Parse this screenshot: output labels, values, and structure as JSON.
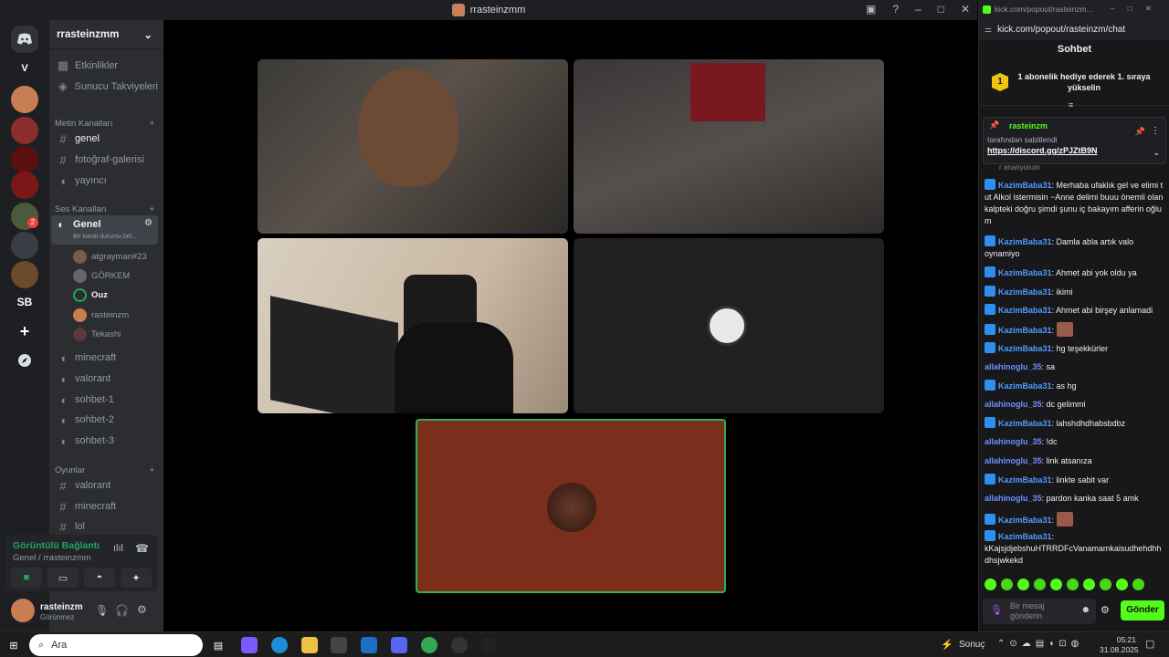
{
  "window": {
    "title": "rrasteinzmm"
  },
  "server": {
    "name": "rrasteinzmm"
  },
  "rail": {
    "dm_letter": "V",
    "sb_label": "SB",
    "badge": "2"
  },
  "channels": {
    "top": [
      "Etkinlikler",
      "Sunucu Takviyeleri"
    ],
    "text_category": "Metin Kanalları",
    "text": [
      "genel",
      "fotoğraf-galerisi",
      "yayıncı"
    ],
    "voice_category": "Ses Kanalları",
    "active_voice": "Genel",
    "active_voice_status": "Bir kanal durumu bel...",
    "voice_users": [
      "atgrayman#23",
      "GÖRKEM",
      "Ouz",
      "rasteinzm",
      "Tekashi"
    ],
    "voice": [
      "minecraft",
      "valorant",
      "sohbet-1",
      "sohbet-2",
      "sohbet-3"
    ],
    "games_category": "Oyunlar",
    "games": [
      "valorant",
      "minecraft",
      "lol"
    ]
  },
  "voice_panel": {
    "status": "Görüntülü Bağlantı",
    "sub": "Genel / rrasteinzmm"
  },
  "user_panel": {
    "name": "rasteinzm",
    "status": "Görünmez"
  },
  "stage": {
    "accent": "#2fb24c",
    "tile_bg": "#7a2e1b"
  },
  "kick": {
    "tab_url": "kick.com/popout/rasteinzm...",
    "url": "kick.com/popout/rasteinzm/chat",
    "header": "Sohbet",
    "goal_rank": "1",
    "goal_text": "1 abonelik hediye ederek 1. sıraya yükselin",
    "pinned_user": "rasteinzm",
    "pinned_by": "tarafından sabitlendi",
    "pinned_link": "https://discord.gg/zPJZtB9N",
    "cut_line": "r ananyorum",
    "messages": [
      {
        "user": "KazimBaba31",
        "text": "Merhaba ufaklık gel ve elimi tut Alkol istermisin ~Anne delimi buuu önemli olan kalpteki doğru şimdi şunu iç bakayım afferin oğlum",
        "badge": true
      },
      {
        "user": "KazimBaba31",
        "text": "Damla abla artık valo oynamiyo",
        "badge": true
      },
      {
        "user": "KazimBaba31",
        "text": "Ahmet abi yok oldu ya",
        "badge": true
      },
      {
        "user": "KazimBaba31",
        "text": "ikimi",
        "badge": true
      },
      {
        "user": "KazimBaba31",
        "text": "Ahmet abi birşey anlamadi",
        "badge": true
      },
      {
        "user": "KazimBaba31",
        "text": "",
        "badge": true,
        "emote": true
      },
      {
        "user": "KazimBaba31",
        "text": "hg teşekkürler",
        "badge": true
      },
      {
        "user": "allahinoglu_35",
        "text": "sa",
        "badge": false
      },
      {
        "user": "KazimBaba31",
        "text": "as hg",
        "badge": true
      },
      {
        "user": "allahinoglu_35",
        "text": "dc gelimmi",
        "badge": false
      },
      {
        "user": "KazimBaba31",
        "text": "lahshdhdhabsbdbz",
        "badge": true
      },
      {
        "user": "allahinoglu_35",
        "text": "!dc",
        "badge": false
      },
      {
        "user": "allahinoglu_35",
        "text": "link atsanıza",
        "badge": false
      },
      {
        "user": "KazimBaba31",
        "text": "linkte sabit var",
        "badge": true
      },
      {
        "user": "allahinoglu_35",
        "text": "pardon kanka saat 5 amk",
        "badge": false
      },
      {
        "user": "KazimBaba31",
        "text": "",
        "badge": true,
        "emote": true
      },
      {
        "user": "KazimBaba31",
        "text": "kKajsjdjebshuHTRRDFcVanamamkaisudhehdhhdhsjwkekd",
        "badge": true
      }
    ],
    "input_placeholder": "Bir mesaj gönderin",
    "send_label": "Gönder"
  },
  "taskbar": {
    "search": "Ara",
    "weather": "Sonuç",
    "time": "05:21",
    "date": "31.08.2025"
  }
}
